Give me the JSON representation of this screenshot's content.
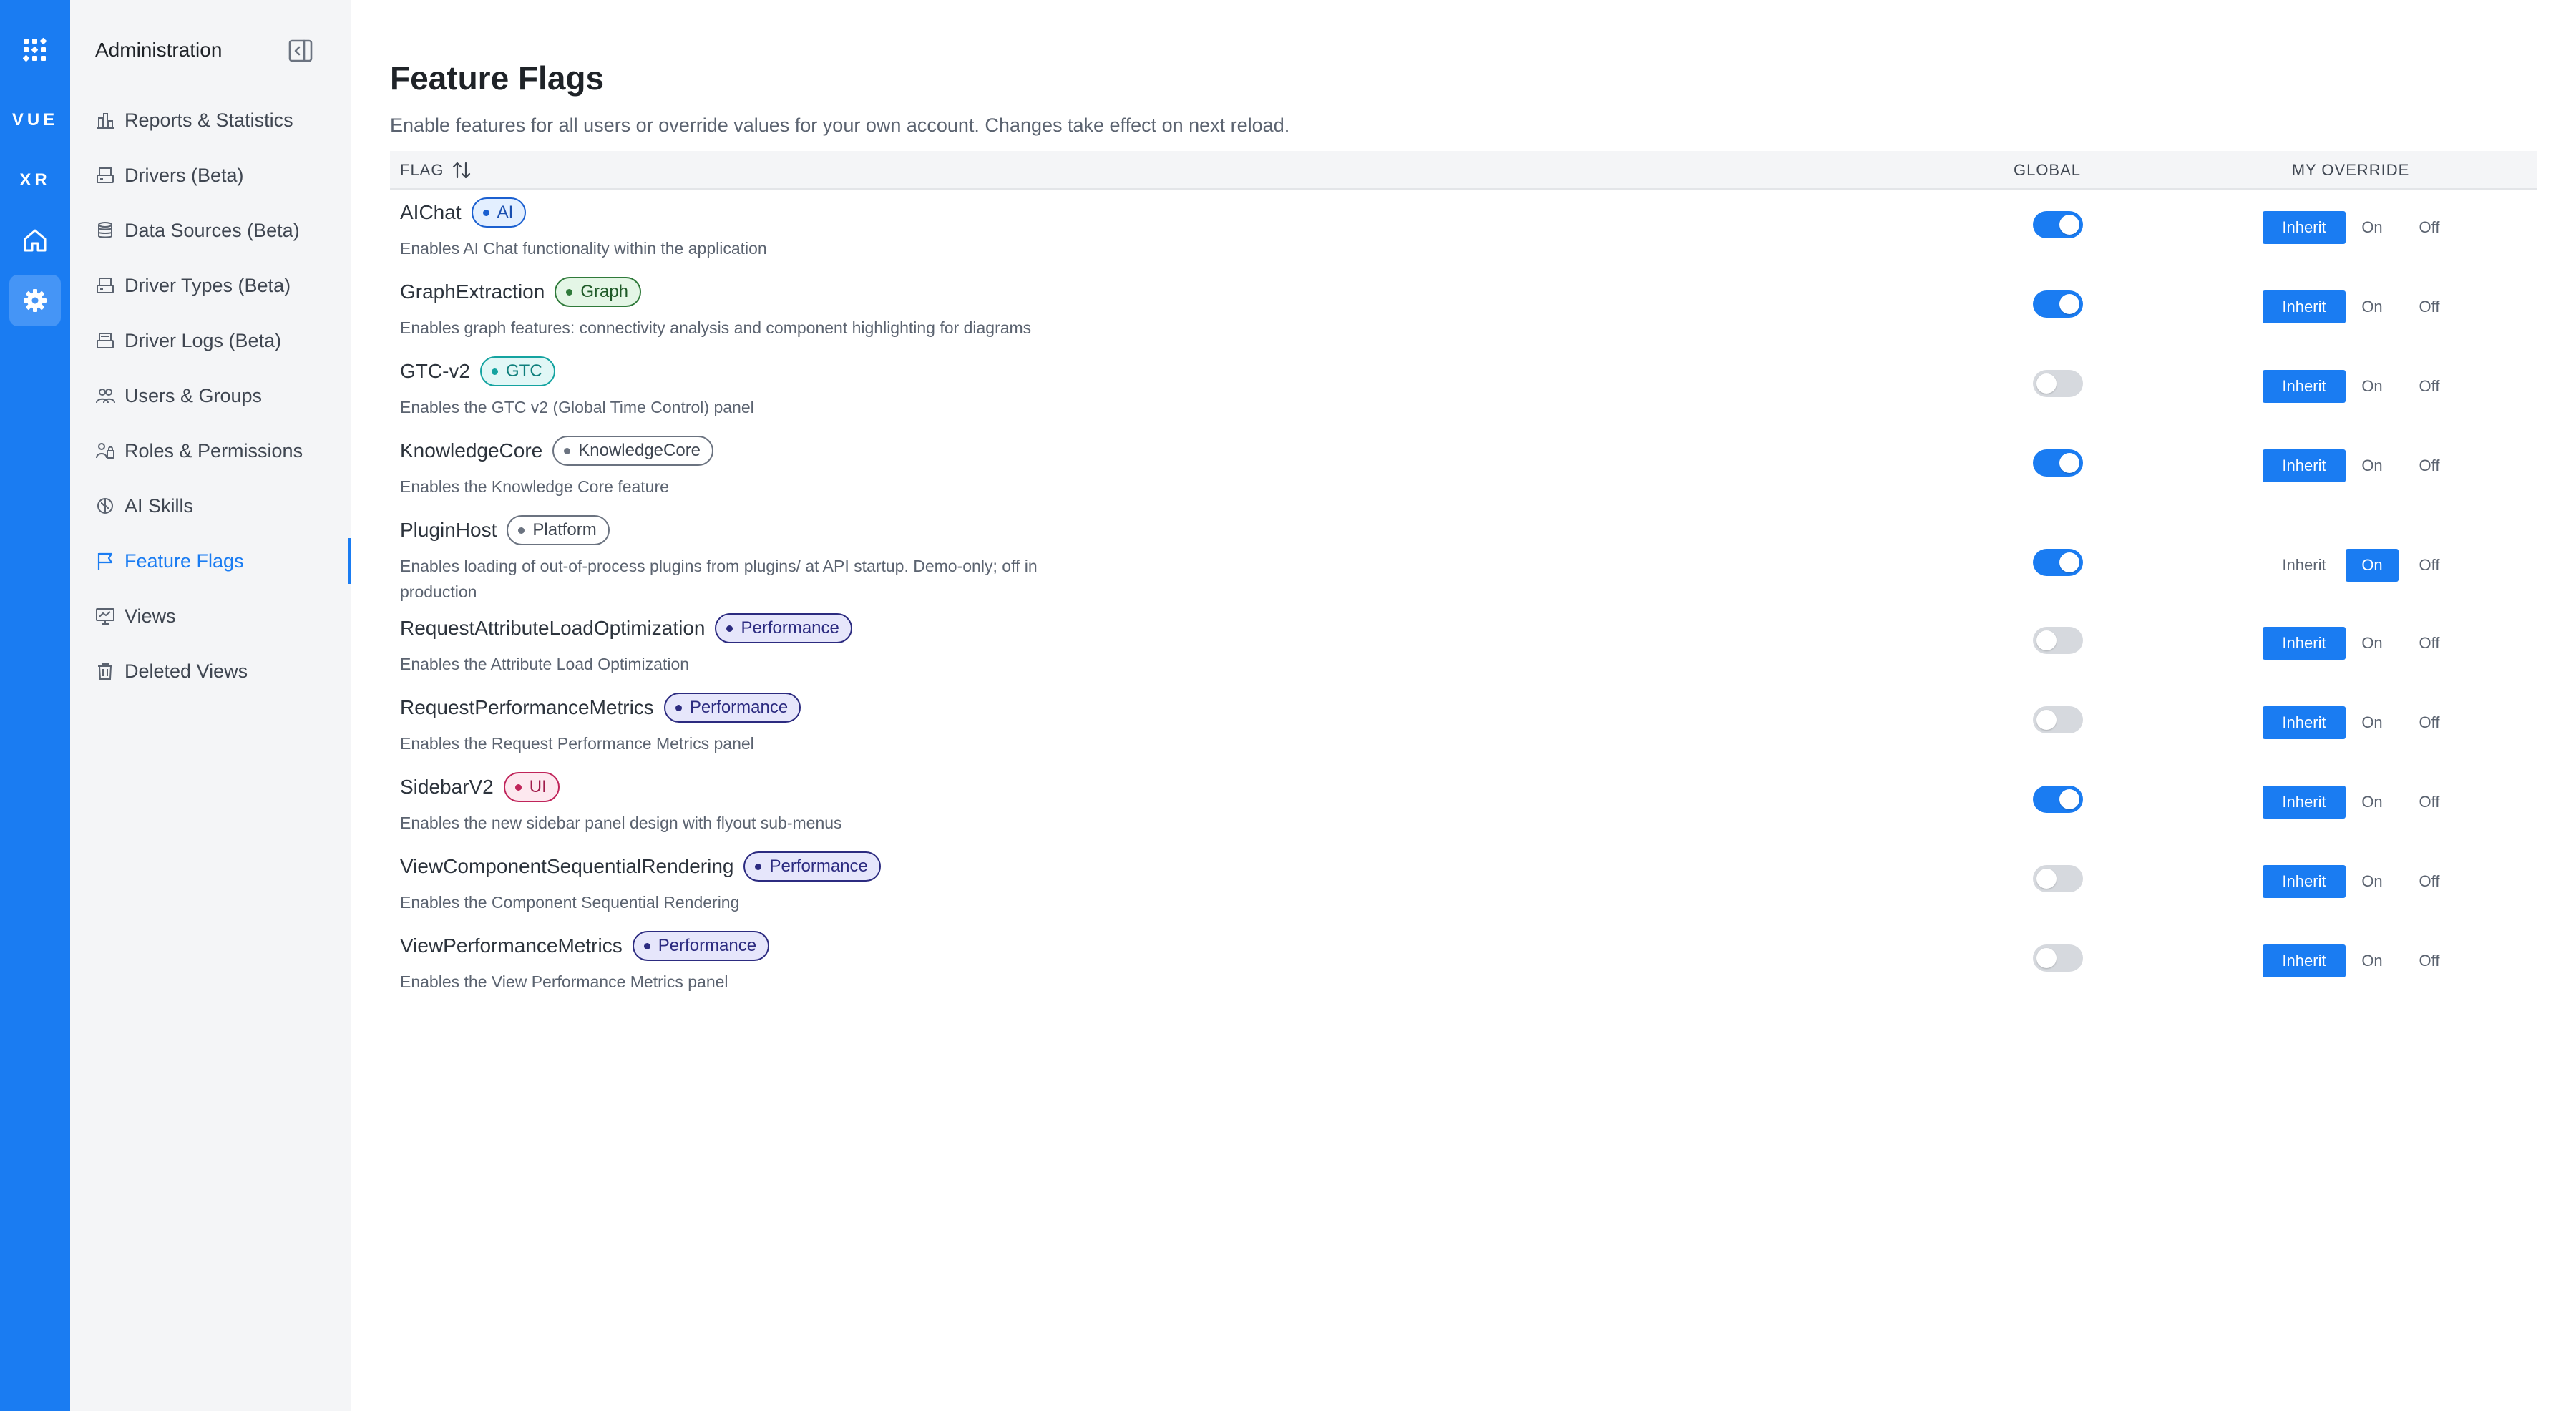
{
  "rail": {
    "items": [
      {
        "id": "logo",
        "icon": "grid-logo-icon"
      },
      {
        "id": "vue",
        "label": "VUE"
      },
      {
        "id": "xr",
        "label": "XR"
      },
      {
        "id": "home",
        "icon": "home-icon"
      },
      {
        "id": "settings",
        "icon": "gear-icon",
        "active": true
      }
    ]
  },
  "sidebar": {
    "title": "Administration",
    "items": [
      {
        "label": "Reports & Statistics",
        "icon": "bar-chart-icon"
      },
      {
        "label": "Drivers (Beta)",
        "icon": "server-icon"
      },
      {
        "label": "Data Sources (Beta)",
        "icon": "database-icon"
      },
      {
        "label": "Driver Types (Beta)",
        "icon": "server-icon"
      },
      {
        "label": "Driver Logs (Beta)",
        "icon": "log-icon"
      },
      {
        "label": "Users & Groups",
        "icon": "users-icon"
      },
      {
        "label": "Roles & Permissions",
        "icon": "roles-icon"
      },
      {
        "label": "AI Skills",
        "icon": "brain-icon"
      },
      {
        "label": "Feature Flags",
        "icon": "flag-icon",
        "active": true
      },
      {
        "label": "Views",
        "icon": "monitor-icon"
      },
      {
        "label": "Deleted Views",
        "icon": "trash-icon"
      }
    ]
  },
  "page": {
    "title": "Feature Flags",
    "subtitle": "Enable features for all users or override values for your own account. Changes take effect on next reload."
  },
  "table": {
    "headers": {
      "flag": "FLAG",
      "global": "GLOBAL",
      "override": "MY OVERRIDE"
    },
    "override_options": [
      "Inherit",
      "On",
      "Off"
    ],
    "rows": [
      {
        "name": "AIChat",
        "badge": "AI",
        "badge_style": "ai",
        "description": "Enables AI Chat functionality within the application",
        "global": true,
        "override": "Inherit"
      },
      {
        "name": "GraphExtraction",
        "badge": "Graph",
        "badge_style": "graph",
        "description": "Enables graph features: connectivity analysis and component highlighting for diagrams",
        "global": true,
        "override": "Inherit"
      },
      {
        "name": "GTC-v2",
        "badge": "GTC",
        "badge_style": "gtc",
        "description": "Enables the GTC v2 (Global Time Control) panel",
        "global": false,
        "override": "Inherit"
      },
      {
        "name": "KnowledgeCore",
        "badge": "KnowledgeCore",
        "badge_style": "neutral",
        "description": "Enables the Knowledge Core feature",
        "global": true,
        "override": "Inherit"
      },
      {
        "name": "PluginHost",
        "badge": "Platform",
        "badge_style": "neutral",
        "description": "Enables loading of out-of-process plugins from plugins/ at API startup. Demo-only; off in production",
        "global": true,
        "override": "On"
      },
      {
        "name": "RequestAttributeLoadOptimization",
        "badge": "Performance",
        "badge_style": "perf",
        "description": "Enables the Attribute Load Optimization",
        "global": false,
        "override": "Inherit"
      },
      {
        "name": "RequestPerformanceMetrics",
        "badge": "Performance",
        "badge_style": "perf",
        "description": "Enables the Request Performance Metrics panel",
        "global": false,
        "override": "Inherit"
      },
      {
        "name": "SidebarV2",
        "badge": "UI",
        "badge_style": "ui",
        "description": "Enables the new sidebar panel design with flyout sub-menus",
        "global": true,
        "override": "Inherit"
      },
      {
        "name": "ViewComponentSequentialRendering",
        "badge": "Performance",
        "badge_style": "perf",
        "description": "Enables the Component Sequential Rendering",
        "global": false,
        "override": "Inherit"
      },
      {
        "name": "ViewPerformanceMetrics",
        "badge": "Performance",
        "badge_style": "perf",
        "description": "Enables the View Performance Metrics panel",
        "global": false,
        "override": "Inherit"
      }
    ]
  },
  "colors": {
    "accent": "#1a7cf2",
    "badge_ai": {
      "bg": "#e3efff",
      "border": "#1a5fd0",
      "text": "#1a4fb0"
    },
    "badge_graph": {
      "bg": "#e4f6e6",
      "border": "#2f7a3a",
      "text": "#1f5a28"
    },
    "badge_gtc": {
      "bg": "#e1f7f6",
      "border": "#14a3a0",
      "text": "#0f7f7c"
    },
    "badge_neutral": {
      "bg": "#ffffff",
      "border": "#6b7380",
      "text": "#3f4651"
    },
    "badge_perf": {
      "bg": "#e6e6fb",
      "border": "#2c2b80",
      "text": "#2c2b80"
    },
    "badge_ui": {
      "bg": "#fde8ef",
      "border": "#c0245a",
      "text": "#a01c4b"
    }
  }
}
